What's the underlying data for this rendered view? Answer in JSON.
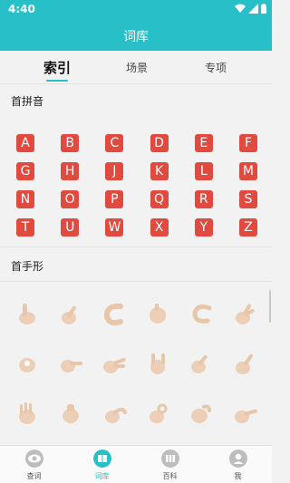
{
  "status_bar": {
    "time": "4:40"
  },
  "app_bar": {
    "title": "词库"
  },
  "tabs": [
    {
      "label": "索引",
      "active": true
    },
    {
      "label": "场景",
      "active": false
    },
    {
      "label": "专项",
      "active": false
    }
  ],
  "pinyin_section": {
    "title": "首拼音",
    "letters": [
      [
        "A",
        "B",
        "C",
        "D",
        "E",
        "F"
      ],
      [
        "G",
        "H",
        "J",
        "K",
        "L",
        "M"
      ],
      [
        "N",
        "O",
        "P",
        "Q",
        "R",
        "S"
      ],
      [
        "T",
        "U",
        "W",
        "X",
        "Y",
        "Z"
      ]
    ]
  },
  "handshape_section": {
    "title": "首手形"
  },
  "bottom_nav": [
    {
      "label": "查词",
      "icon": "eye-icon",
      "active": false
    },
    {
      "label": "词库",
      "icon": "book-icon",
      "active": true
    },
    {
      "label": "百科",
      "icon": "library-icon",
      "active": false
    },
    {
      "label": "我",
      "icon": "person-icon",
      "active": false
    }
  ],
  "colors": {
    "primary": "#27bfc8",
    "letter_bg": "#e04a3f"
  }
}
